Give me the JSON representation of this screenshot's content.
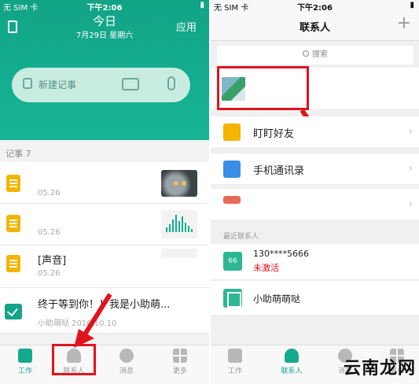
{
  "left": {
    "status": {
      "carrier": "无 SIM 卡",
      "time": "下午2:06"
    },
    "header": {
      "title": "今日",
      "date": "7月29日  星期六",
      "apps": "应用"
    },
    "search": {
      "placeholder": "新建记事"
    },
    "section": "记事 7",
    "notes": [
      {
        "title": "",
        "date": "05.26"
      },
      {
        "title": "",
        "date": "05.26"
      },
      {
        "title": "[声音]",
        "date": "05.26"
      },
      {
        "title": "终于等到你！！我是小助萌...",
        "date": "小助萌哒   2016.10.10"
      }
    ],
    "tabs": [
      {
        "label": "工作"
      },
      {
        "label": "联系人"
      },
      {
        "label": "消息"
      },
      {
        "label": "更多"
      }
    ]
  },
  "right": {
    "status": {
      "carrier": "无 SIM 卡",
      "time": "下午2:06"
    },
    "header": {
      "title": "联系人",
      "add": "+"
    },
    "search": {
      "placeholder": "搜索"
    },
    "rows": [
      {
        "label": "盯盯好友"
      },
      {
        "label": "手机通讯录"
      },
      {
        "label": ""
      }
    ],
    "recent": "最近联系人",
    "contacts": [
      {
        "badge": "66",
        "name": "130****5666",
        "state": "未激活"
      },
      {
        "name": "小助萌萌哒"
      }
    ],
    "tabs": [
      {
        "label": "工作"
      },
      {
        "label": "联系人"
      },
      {
        "label": "消息"
      },
      {
        "label": "更多"
      }
    ]
  },
  "watermark": "云南龙网",
  "colors": {
    "brand_green": "#17a98c",
    "highlight_red": "#e0141e",
    "orange": "#f4b400",
    "blue": "#3a8ee6"
  }
}
